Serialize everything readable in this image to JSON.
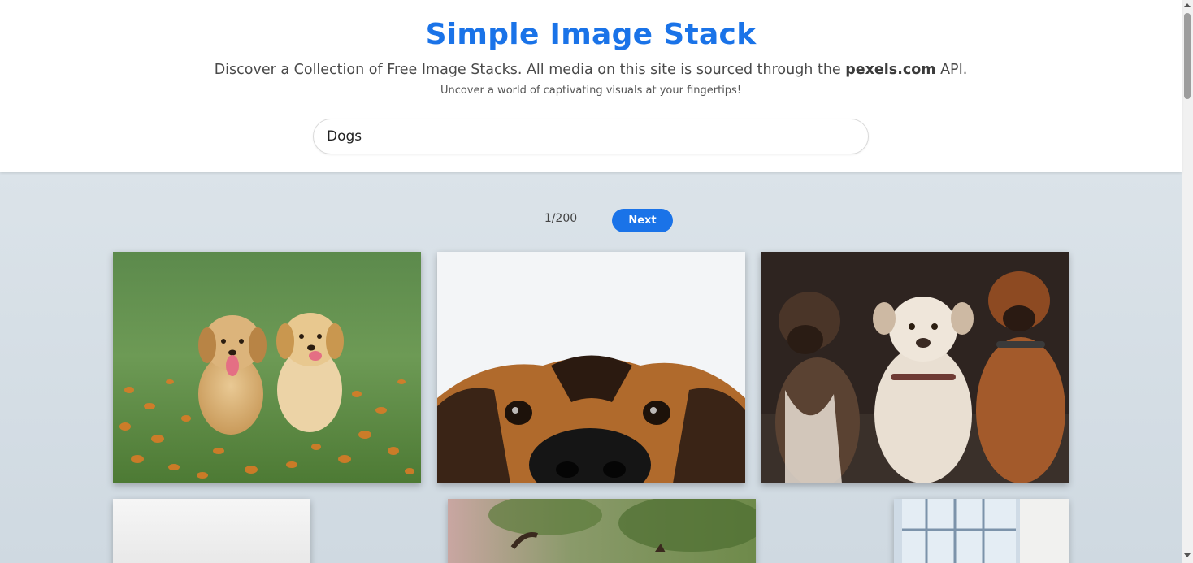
{
  "header": {
    "title": "Simple Image Stack",
    "subtitle_before": "Discover a Collection of Free Image Stacks. All media on this site is sourced through the ",
    "subtitle_brand": "pexels.com",
    "subtitle_after": " API.",
    "tagline": "Uncover a world of captivating visuals at your fingertips!"
  },
  "search": {
    "value": "Dogs"
  },
  "pagination": {
    "count": "1/200",
    "next_label": "Next"
  },
  "colors": {
    "accent": "#1a73e8",
    "header_bg": "#ffffff",
    "content_bg": "#d6dfe6"
  },
  "photos": [
    {
      "subject": "golden-retriever-puppies-in-flower-field"
    },
    {
      "subject": "dog-nose-closeup-white-background"
    },
    {
      "subject": "three-boxer-dogs-dark-background"
    },
    {
      "subject": "white-background-photo"
    },
    {
      "subject": "dog-outdoors-trees"
    },
    {
      "subject": "window-light-photo"
    }
  ]
}
